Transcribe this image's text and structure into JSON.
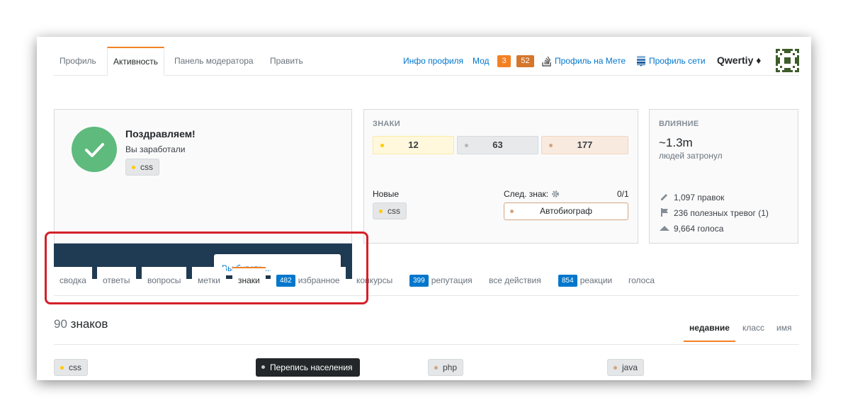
{
  "top_tabs": [
    "Профиль",
    "Активность",
    "Панель модератора",
    "Править"
  ],
  "header_links": {
    "profile_info": "Инфо профиля",
    "mod": "Мод",
    "mod_count_1": "3",
    "mod_count_2": "52",
    "meta_profile": "Профиль на Мете",
    "network_profile": "Профиль сети"
  },
  "user": {
    "name": "Qwertiy ♦"
  },
  "congrats": {
    "title": "Поздравляем!",
    "subtitle": "Вы заработали",
    "badge": "css"
  },
  "badges_card": {
    "title": "ЗНАКИ",
    "gold": "12",
    "silver": "63",
    "bronze": "177",
    "new_label": "Новые",
    "new_badge": "css",
    "next_label": "След. знак:",
    "next_progress": "0/1",
    "next_badge": "Автобиограф"
  },
  "impact_card": {
    "title": "ВЛИЯНИЕ",
    "reach": "~1.3m",
    "reach_label": "людей затронул",
    "edits": "1,097 правок",
    "flags": "236 полезных тревог (1)",
    "votes": "9,664 голоса"
  },
  "popup": {
    "text": "Вы будете ..."
  },
  "sub_tabs": {
    "summary": "сводка",
    "answers": "ответы",
    "questions": "вопросы",
    "tags": "метки",
    "badges": "знаки",
    "favorites_count": "482",
    "favorites": "избранное",
    "bounties": "конкурсы",
    "reputation_count": "399",
    "reputation": "репутация",
    "all_actions": "все действия",
    "reactions_count": "854",
    "reactions": "реакции",
    "votes": "голоса"
  },
  "badges_list": {
    "count": "90",
    "count_label": "знаков",
    "sort": [
      "недавние",
      "класс",
      "имя"
    ],
    "items": [
      "css",
      "Перепись населения",
      "php",
      "java"
    ]
  }
}
